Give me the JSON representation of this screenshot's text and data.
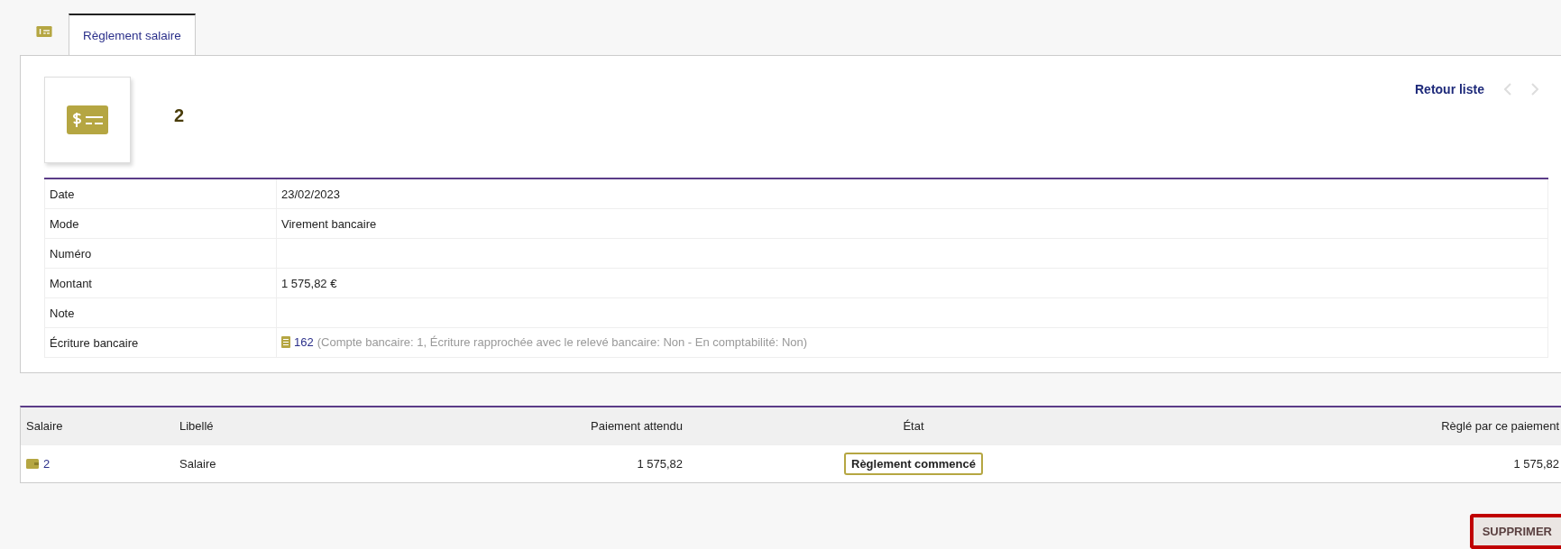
{
  "tabs": [
    {
      "label": "Règlement salaire",
      "selected": true
    }
  ],
  "header": {
    "ref": "2",
    "back_link": "Retour liste",
    "prev_disabled": true,
    "next_disabled": true
  },
  "fields": [
    {
      "label": "Date",
      "value": "23/02/2023"
    },
    {
      "label": "Mode",
      "value": "Virement bancaire"
    },
    {
      "label": "Numéro"
    },
    {
      "label": "Montant",
      "value": "1 575,82 €"
    },
    {
      "label": "Note"
    },
    {
      "label": "Écriture bancaire",
      "kind": "bank",
      "link": "162",
      "detail": "(Compte bancaire: 1, Écriture rapprochée avec le relevé bancaire: Non - En comptabilité: Non)"
    }
  ],
  "table": {
    "columns": [
      "Salaire",
      "Libellé",
      "Paiement attendu",
      "État",
      "Règlé par ce paiement"
    ],
    "rows": [
      {
        "salary": "2",
        "label": "Salaire",
        "expected": "1 575,82",
        "status": "Règlement commencé",
        "paid": "1 575,82"
      }
    ]
  },
  "buttons": [
    {
      "label": "SUPPRIMER",
      "highlighted": true
    }
  ]
}
